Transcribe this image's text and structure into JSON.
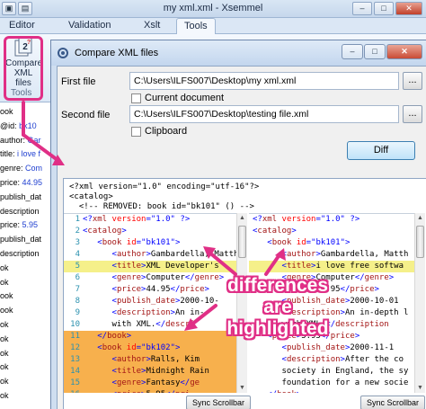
{
  "main_window": {
    "title": "my xml.xml - Xsemmel",
    "tabs": [
      "Editor",
      "Validation",
      "Xslt",
      "Tools"
    ],
    "compare_button_label": "Compare XML files",
    "tools_group_label": "Tools",
    "tree_items": [
      {
        "k": "ook",
        "v": ""
      },
      {
        "k": "@id: ",
        "v": "bk10"
      },
      {
        "k": "author: ",
        "v": "Gar"
      },
      {
        "k": "title: ",
        "v": "i love f"
      },
      {
        "k": "genre: ",
        "v": "Com"
      },
      {
        "k": "price: ",
        "v": "44.95"
      },
      {
        "k": "publish_dat",
        "v": ""
      },
      {
        "k": "description",
        "v": ""
      },
      {
        "k": "price: ",
        "v": "5.95"
      },
      {
        "k": "publish_dat",
        "v": ""
      },
      {
        "k": "description",
        "v": ""
      },
      {
        "k": "ok",
        "v": ""
      },
      {
        "k": "ok",
        "v": ""
      },
      {
        "k": "ook",
        "v": ""
      },
      {
        "k": "ook",
        "v": ""
      },
      {
        "k": "ok",
        "v": ""
      },
      {
        "k": "ok",
        "v": ""
      },
      {
        "k": "ok",
        "v": ""
      },
      {
        "k": "ok",
        "v": ""
      },
      {
        "k": "ok",
        "v": ""
      },
      {
        "k": "ok",
        "v": ""
      }
    ]
  },
  "dialog": {
    "title": "Compare XML files",
    "first_file_label": "First file",
    "first_file_path": "C:\\Users\\ILFS007\\Desktop\\my xml.xml",
    "current_document_label": "Current document",
    "second_file_label": "Second file",
    "second_file_path": "C:\\Users\\ILFS007\\Desktop\\testing file.xml",
    "clipboard_label": "Clipboard",
    "browse_label": "...",
    "diff_button": "Diff",
    "summary_lines": [
      "<?xml version=\"1.0\" encoding=\"utf-16\"?>",
      "<catalog>",
      "  <!-- REMOVED: book id=\"bk101\" () -->"
    ],
    "sync_label": "Sync Scrollbar"
  },
  "left_pane": [
    {
      "n": "1",
      "hl": "",
      "segs": [
        [
          "b",
          "<?"
        ],
        [
          "t",
          "xml"
        ],
        [
          "a",
          " version"
        ],
        [
          "b",
          "=\"1.0\" ?>"
        ]
      ]
    },
    {
      "n": "2",
      "hl": "",
      "segs": [
        [
          "b",
          "<"
        ],
        [
          "t",
          "catalog"
        ],
        [
          "b",
          ">"
        ]
      ]
    },
    {
      "n": "3",
      "hl": "",
      "segs": [
        [
          "tx",
          "   "
        ],
        [
          "b",
          "<"
        ],
        [
          "t",
          "book"
        ],
        [
          "a",
          " id"
        ],
        [
          "b",
          "=\"bk101\">"
        ]
      ]
    },
    {
      "n": "4",
      "hl": "",
      "segs": [
        [
          "tx",
          "      "
        ],
        [
          "b",
          "<"
        ],
        [
          "t",
          "author"
        ],
        [
          "b",
          ">"
        ],
        [
          "tx",
          "Gambardella, Matth"
        ]
      ]
    },
    {
      "n": "5",
      "hl": "yellow",
      "segs": [
        [
          "tx",
          "      "
        ],
        [
          "b",
          "<"
        ],
        [
          "t",
          "title"
        ],
        [
          "b",
          ">"
        ],
        [
          "tx",
          "XML Developer's"
        ]
      ]
    },
    {
      "n": "6",
      "hl": "",
      "segs": [
        [
          "tx",
          "      "
        ],
        [
          "b",
          "<"
        ],
        [
          "t",
          "genre"
        ],
        [
          "b",
          ">"
        ],
        [
          "tx",
          "Computer"
        ],
        [
          "b",
          "</"
        ],
        [
          "t",
          "genre"
        ],
        [
          "b",
          ">"
        ]
      ]
    },
    {
      "n": "7",
      "hl": "",
      "segs": [
        [
          "tx",
          "      "
        ],
        [
          "b",
          "<"
        ],
        [
          "t",
          "price"
        ],
        [
          "b",
          ">"
        ],
        [
          "tx",
          "44.95"
        ],
        [
          "b",
          "</"
        ],
        [
          "t",
          "price"
        ],
        [
          "b",
          ">"
        ]
      ]
    },
    {
      "n": "8",
      "hl": "",
      "segs": [
        [
          "tx",
          "      "
        ],
        [
          "b",
          "<"
        ],
        [
          "t",
          "publish_date"
        ],
        [
          "b",
          ">"
        ],
        [
          "tx",
          "2000-10-"
        ]
      ]
    },
    {
      "n": "9",
      "hl": "",
      "segs": [
        [
          "tx",
          "      "
        ],
        [
          "b",
          "<"
        ],
        [
          "t",
          "description"
        ],
        [
          "b",
          ">"
        ],
        [
          "tx",
          "An in-"
        ]
      ]
    },
    {
      "n": "10",
      "hl": "",
      "segs": [
        [
          "tx",
          "      with XML."
        ],
        [
          "b",
          "</"
        ],
        [
          "t",
          "descri"
        ]
      ]
    },
    {
      "n": "11",
      "hl": "orange",
      "segs": [
        [
          "tx",
          "   "
        ],
        [
          "b",
          "</"
        ],
        [
          "t",
          "book"
        ],
        [
          "b",
          ">"
        ]
      ]
    },
    {
      "n": "12",
      "hl": "orange",
      "segs": [
        [
          "tx",
          "   "
        ],
        [
          "b",
          "<"
        ],
        [
          "t",
          "book"
        ],
        [
          "a",
          " id"
        ],
        [
          "b",
          "=\"bk102\">"
        ]
      ]
    },
    {
      "n": "13",
      "hl": "orange",
      "segs": [
        [
          "tx",
          "      "
        ],
        [
          "b",
          "<"
        ],
        [
          "t",
          "author"
        ],
        [
          "b",
          ">"
        ],
        [
          "tx",
          "Ralls, Kim"
        ]
      ]
    },
    {
      "n": "14",
      "hl": "orange",
      "segs": [
        [
          "tx",
          "      "
        ],
        [
          "b",
          "<"
        ],
        [
          "t",
          "title"
        ],
        [
          "b",
          ">"
        ],
        [
          "tx",
          "Midnight Rain"
        ]
      ]
    },
    {
      "n": "15",
      "hl": "orange",
      "segs": [
        [
          "tx",
          "      "
        ],
        [
          "b",
          "<"
        ],
        [
          "t",
          "genre"
        ],
        [
          "b",
          ">"
        ],
        [
          "tx",
          "Fantasy"
        ],
        [
          "b",
          "</"
        ],
        [
          "t",
          "ge"
        ]
      ]
    },
    {
      "n": "16",
      "hl": "orange",
      "segs": [
        [
          "tx",
          "      "
        ],
        [
          "b",
          "<"
        ],
        [
          "t",
          "price"
        ],
        [
          "b",
          ">"
        ],
        [
          "tx",
          "5.95"
        ],
        [
          "b",
          "</"
        ],
        [
          "t",
          "pri"
        ]
      ]
    }
  ],
  "right_pane": [
    {
      "hl": "",
      "segs": [
        [
          "b",
          "<?"
        ],
        [
          "t",
          "xml"
        ],
        [
          "a",
          " version"
        ],
        [
          "b",
          "=\"1.0\" ?>"
        ]
      ]
    },
    {
      "hl": "",
      "segs": [
        [
          "b",
          "<"
        ],
        [
          "t",
          "catalog"
        ],
        [
          "b",
          ">"
        ]
      ]
    },
    {
      "hl": "",
      "segs": [
        [
          "tx",
          "   "
        ],
        [
          "b",
          "<"
        ],
        [
          "t",
          "book"
        ],
        [
          "a",
          " id"
        ],
        [
          "b",
          "=\"bk101\">"
        ]
      ]
    },
    {
      "hl": "",
      "segs": [
        [
          "tx",
          "      "
        ],
        [
          "b",
          "<"
        ],
        [
          "t",
          "author"
        ],
        [
          "b",
          ">"
        ],
        [
          "tx",
          "Gambardella, Matth"
        ]
      ]
    },
    {
      "hl": "yellow",
      "segs": [
        [
          "tx",
          "      "
        ],
        [
          "b",
          "<"
        ],
        [
          "t",
          "title"
        ],
        [
          "b",
          ">"
        ],
        [
          "tx",
          "i love free softwa"
        ]
      ]
    },
    {
      "hl": "",
      "segs": [
        [
          "tx",
          "      "
        ],
        [
          "b",
          "<"
        ],
        [
          "t",
          "genre"
        ],
        [
          "b",
          ">"
        ],
        [
          "tx",
          "Computer"
        ],
        [
          "b",
          "</"
        ],
        [
          "t",
          "genre"
        ],
        [
          "b",
          ">"
        ]
      ]
    },
    {
      "hl": "",
      "segs": [
        [
          "tx",
          "      "
        ],
        [
          "b",
          "<"
        ],
        [
          "t",
          "price"
        ],
        [
          "b",
          ">"
        ],
        [
          "tx",
          "44.95"
        ],
        [
          "b",
          "</"
        ],
        [
          "t",
          "price"
        ],
        [
          "b",
          ">"
        ]
      ]
    },
    {
      "hl": "",
      "segs": [
        [
          "tx",
          "      "
        ],
        [
          "b",
          "<"
        ],
        [
          "t",
          "publish_date"
        ],
        [
          "b",
          ">"
        ],
        [
          "tx",
          "2000-10-01"
        ]
      ]
    },
    {
      "hl": "",
      "segs": [
        [
          "tx",
          "      "
        ],
        [
          "b",
          "<"
        ],
        [
          "t",
          "description"
        ],
        [
          "b",
          ">"
        ],
        [
          "tx",
          "An in-depth l"
        ]
      ]
    },
    {
      "hl": "",
      "segs": [
        [
          "tx",
          "      with XML."
        ],
        [
          "b",
          "</"
        ],
        [
          "t",
          "description"
        ]
      ]
    },
    {
      "hl": "",
      "segs": [
        [
          "tx",
          "   "
        ],
        [
          "b",
          "<"
        ],
        [
          "t",
          "price"
        ],
        [
          "b",
          ">"
        ],
        [
          "tx",
          "5.95"
        ],
        [
          "b",
          "</"
        ],
        [
          "t",
          "price"
        ],
        [
          "b",
          ">"
        ]
      ]
    },
    {
      "hl": "",
      "segs": [
        [
          "tx",
          "      "
        ],
        [
          "b",
          "<"
        ],
        [
          "t",
          "publish_date"
        ],
        [
          "b",
          ">"
        ],
        [
          "tx",
          "2000-11-1"
        ]
      ]
    },
    {
      "hl": "",
      "segs": [
        [
          "tx",
          "      "
        ],
        [
          "b",
          "<"
        ],
        [
          "t",
          "description"
        ],
        [
          "b",
          ">"
        ],
        [
          "tx",
          "After the co"
        ]
      ]
    },
    {
      "hl": "",
      "segs": [
        [
          "tx",
          "      society in England, the sy"
        ]
      ]
    },
    {
      "hl": "",
      "segs": [
        [
          "tx",
          "      foundation for a new socie"
        ]
      ]
    },
    {
      "hl": "",
      "segs": [
        [
          "tx",
          "   "
        ],
        [
          "b",
          "</"
        ],
        [
          "t",
          "book"
        ],
        [
          "b",
          ">"
        ]
      ]
    }
  ],
  "annotation": {
    "text": "differences are highlighted",
    "color": "#e02f86"
  },
  "colors": {
    "highlight_yellow": "#f5f08a",
    "highlight_orange": "#f7b04d",
    "callout": "#e02f86"
  }
}
